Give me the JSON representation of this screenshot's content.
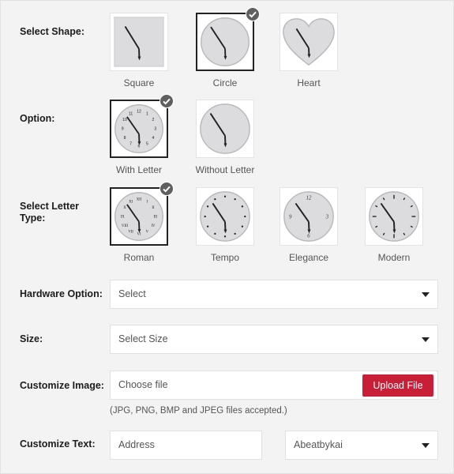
{
  "shape": {
    "label": "Select Shape:",
    "options": [
      {
        "label": "Square",
        "shape": "square",
        "selected": false
      },
      {
        "label": "Circle",
        "shape": "circle",
        "selected": true
      },
      {
        "label": "Heart",
        "shape": "heart",
        "selected": false
      }
    ]
  },
  "option": {
    "label": "Option:",
    "options": [
      {
        "label": "With Letter",
        "selected": true
      },
      {
        "label": "Without Letter",
        "selected": false
      }
    ]
  },
  "letter_type": {
    "label": "Select Letter Type:",
    "options": [
      {
        "label": "Roman",
        "selected": true
      },
      {
        "label": "Tempo",
        "selected": false
      },
      {
        "label": "Elegance",
        "selected": false,
        "numerals": [
          "12",
          "3",
          "6",
          "9"
        ]
      },
      {
        "label": "Modern",
        "selected": false
      }
    ]
  },
  "with_letter_numerals": [
    "12",
    "1",
    "2",
    "3",
    "4",
    "5",
    "6",
    "7",
    "8",
    "9",
    "10",
    "11"
  ],
  "roman_numerals": [
    "XII",
    "I",
    "II",
    "III",
    "IV",
    "V",
    "VI",
    "VII",
    "VIII",
    "IX",
    "X",
    "XI"
  ],
  "hardware": {
    "label": "Hardware Option:",
    "value": "Select"
  },
  "size": {
    "label": "Size:",
    "value": "Select Size"
  },
  "customize_image": {
    "label": "Customize Image:",
    "file_text": "Choose file",
    "button": "Upload File",
    "note": "(JPG, PNG, BMP and JPEG files accepted.)"
  },
  "customize_text": {
    "label": "Customize Text:",
    "placeholder": "Address",
    "font_value": "Abeatbykai"
  },
  "colors": {
    "accent": "#c81e37",
    "check": "#5f5f5f",
    "clock_face": "#dcdcdf"
  }
}
